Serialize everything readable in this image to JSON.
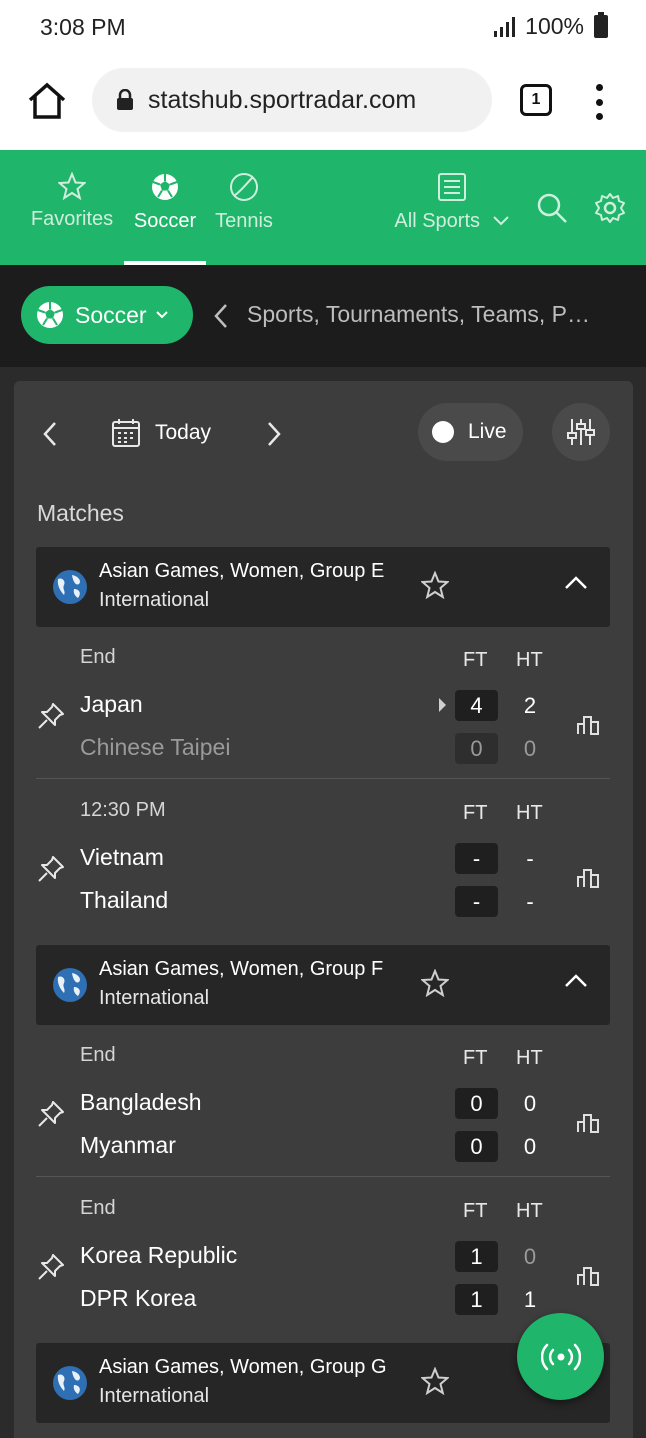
{
  "status_bar": {
    "time": "3:08 PM",
    "battery": "100%"
  },
  "browser": {
    "url": "statshub.sportradar.com",
    "tab_count": "1"
  },
  "nav": {
    "favorites": "Favorites",
    "soccer": "Soccer",
    "tennis": "Tennis",
    "all_sports": "All Sports",
    "active": "Soccer"
  },
  "subbar": {
    "sport": "Soccer",
    "search_placeholder": "Sports, Tournaments, Teams, P…"
  },
  "datebar": {
    "label": "Today",
    "live_label": "Live"
  },
  "matches_title": "Matches",
  "tournaments": [
    {
      "name": "Asian Games, Women, Group E",
      "country": "International",
      "matches": [
        {
          "status": "End",
          "ft_label": "FT",
          "ht_label": "HT",
          "home": "Japan",
          "away": "Chinese Taipei",
          "home_ft": "4",
          "away_ft": "0",
          "home_ht": "2",
          "away_ht": "0"
        },
        {
          "status": "12:30 PM",
          "ft_label": "FT",
          "ht_label": "HT",
          "home": "Vietnam",
          "away": "Thailand",
          "home_ft": "-",
          "away_ft": "-",
          "home_ht": "-",
          "away_ht": "-"
        }
      ]
    },
    {
      "name": "Asian Games, Women, Group F",
      "country": "International",
      "matches": [
        {
          "status": "End",
          "ft_label": "FT",
          "ht_label": "HT",
          "home": "Bangladesh",
          "away": "Myanmar",
          "home_ft": "0",
          "away_ft": "0",
          "home_ht": "0",
          "away_ht": "0"
        },
        {
          "status": "End",
          "ft_label": "FT",
          "ht_label": "HT",
          "home": "Korea Republic",
          "away": "DPR Korea",
          "home_ft": "1",
          "away_ft": "1",
          "home_ht": "0",
          "away_ht": "1"
        }
      ]
    },
    {
      "name": "Asian Games, Women, Group G",
      "country": "International",
      "matches": []
    }
  ],
  "colors": {
    "brand_green": "#1fb56b",
    "card_bg": "#3d3d3d",
    "page_bg": "#2b2b2b"
  }
}
